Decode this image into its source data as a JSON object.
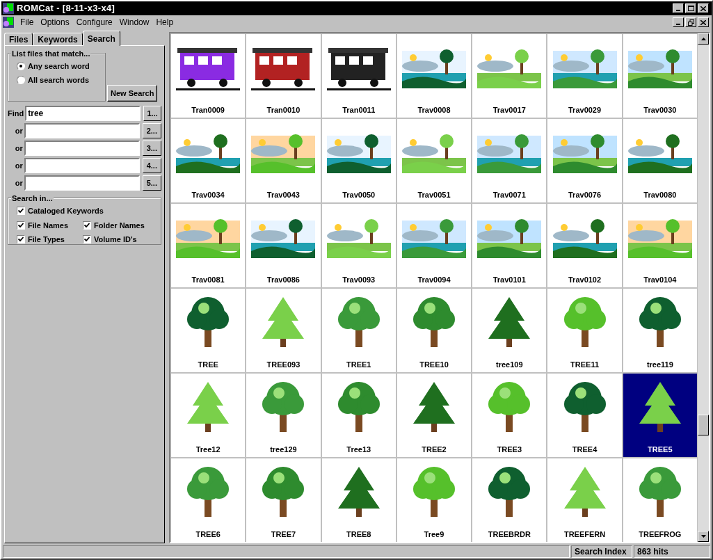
{
  "window": {
    "title": "ROMCat - [8-11-x3-x4]"
  },
  "menu": [
    "File",
    "Options",
    "Configure",
    "Window",
    "Help"
  ],
  "tabs": [
    {
      "label": "Files",
      "selected": false
    },
    {
      "label": "Keywords",
      "selected": false
    },
    {
      "label": "Search",
      "selected": true
    }
  ],
  "match_group": {
    "title": "List files that match...",
    "options": [
      {
        "label": "Any search word",
        "selected": true
      },
      {
        "label": "All search words",
        "selected": false
      }
    ]
  },
  "new_search_button": "New Search",
  "find_rows": [
    {
      "label": "Find",
      "value": "tree",
      "button": "1..."
    },
    {
      "label": "or",
      "button": "2..."
    },
    {
      "label": "or",
      "button": "3..."
    },
    {
      "label": "or",
      "button": "4..."
    },
    {
      "label": "or",
      "button": "5..."
    }
  ],
  "search_in": {
    "title": "Search in...",
    "options": [
      {
        "label": "Cataloged Keywords",
        "checked": true
      },
      {
        "label": "File Names",
        "checked": true
      },
      {
        "label": "Folder Names",
        "checked": true
      },
      {
        "label": "File Types",
        "checked": true
      },
      {
        "label": "Volume ID's",
        "checked": true
      }
    ]
  },
  "thumbnails": [
    {
      "label": "Tran0009",
      "selected": false
    },
    {
      "label": "Tran0010",
      "selected": false
    },
    {
      "label": "Tran0011",
      "selected": false
    },
    {
      "label": "Trav0008",
      "selected": false
    },
    {
      "label": "Trav0017",
      "selected": false
    },
    {
      "label": "Trav0029",
      "selected": false
    },
    {
      "label": "Trav0030",
      "selected": false
    },
    {
      "label": "Trav0034",
      "selected": false
    },
    {
      "label": "Trav0043",
      "selected": false
    },
    {
      "label": "Trav0050",
      "selected": false
    },
    {
      "label": "Trav0051",
      "selected": false
    },
    {
      "label": "Trav0071",
      "selected": false
    },
    {
      "label": "Trav0076",
      "selected": false
    },
    {
      "label": "Trav0080",
      "selected": false
    },
    {
      "label": "Trav0081",
      "selected": false
    },
    {
      "label": "Trav0086",
      "selected": false
    },
    {
      "label": "Trav0093",
      "selected": false
    },
    {
      "label": "Trav0094",
      "selected": false
    },
    {
      "label": "Trav0101",
      "selected": false
    },
    {
      "label": "Trav0102",
      "selected": false
    },
    {
      "label": "Trav0104",
      "selected": false
    },
    {
      "label": "TREE",
      "selected": false
    },
    {
      "label": "TREE093",
      "selected": false
    },
    {
      "label": "TREE1",
      "selected": false
    },
    {
      "label": "TREE10",
      "selected": false
    },
    {
      "label": "tree109",
      "selected": false
    },
    {
      "label": "TREE11",
      "selected": false
    },
    {
      "label": "tree119",
      "selected": false
    },
    {
      "label": "Tree12",
      "selected": false
    },
    {
      "label": "tree129",
      "selected": false
    },
    {
      "label": "Tree13",
      "selected": false
    },
    {
      "label": "TREE2",
      "selected": false
    },
    {
      "label": "TREE3",
      "selected": false
    },
    {
      "label": "TREE4",
      "selected": false
    },
    {
      "label": "TREE5",
      "selected": true
    },
    {
      "label": "TREE6",
      "selected": false
    },
    {
      "label": "TREE7",
      "selected": false
    },
    {
      "label": "TREE8",
      "selected": false
    },
    {
      "label": "Tree9",
      "selected": false
    },
    {
      "label": "TREEBRDR",
      "selected": false
    },
    {
      "label": "TREEFERN",
      "selected": false
    },
    {
      "label": "TREEFROG",
      "selected": false
    }
  ],
  "status_bar": {
    "panel": "Search Index",
    "hits": "863 hits"
  }
}
